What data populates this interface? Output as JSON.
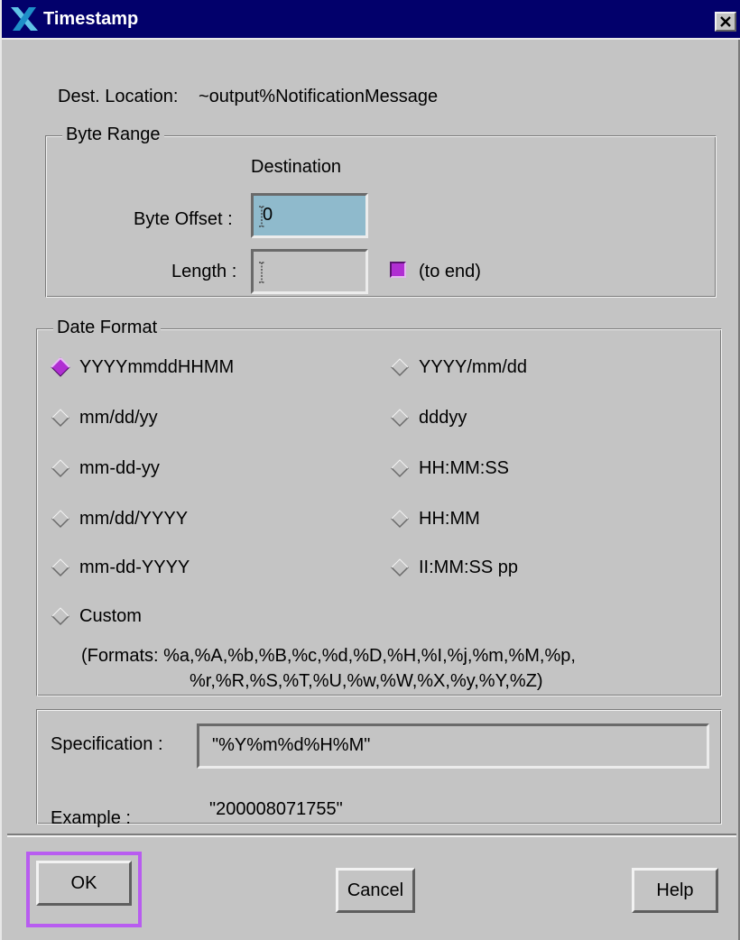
{
  "window": {
    "title": "Timestamp",
    "close_icon": "close-x-icon",
    "logo_icon": "x-window-logo-icon"
  },
  "dest": {
    "label": "Dest. Location:",
    "value": "~output%NotificationMessage"
  },
  "byte_range": {
    "group_title": "Byte Range",
    "column_header": "Destination",
    "offset_label": "Byte Offset :",
    "offset_value": "0",
    "length_label": "Length :",
    "length_value": "",
    "to_end_label": "(to end)",
    "to_end_checked": true
  },
  "date_format": {
    "group_title": "Date Format",
    "selected": "YYYYmmddHHMM",
    "options_left": [
      "YYYYmmddHHMM",
      "mm/dd/yy",
      "mm-dd-yy",
      "mm/dd/YYYY",
      "mm-dd-YYYY",
      "Custom"
    ],
    "options_right": [
      "YYYY/mm/dd",
      "dddyy",
      "HH:MM:SS",
      "HH:MM",
      "II:MM:SS pp"
    ],
    "formats_line1": "(Formats:  %a,%A,%b,%B,%c,%d,%D,%H,%I,%j,%m,%M,%p,",
    "formats_line2": "%r,%R,%S,%T,%U,%w,%W,%X,%y,%Y,%Z)"
  },
  "spec": {
    "label": "Specification :",
    "value": "\"%Y%m%d%H%M\"",
    "example_label": "Example :",
    "example_value": "\"200008071755\""
  },
  "buttons": {
    "ok": "OK",
    "cancel": "Cancel",
    "help": "Help"
  },
  "colors": {
    "title_bar": "#02006b",
    "dialog_bg": "#c4c4c4",
    "active_field": "#8fbacc",
    "selection_accent": "#b02ed2",
    "focus_ring": "#b85cf0"
  }
}
